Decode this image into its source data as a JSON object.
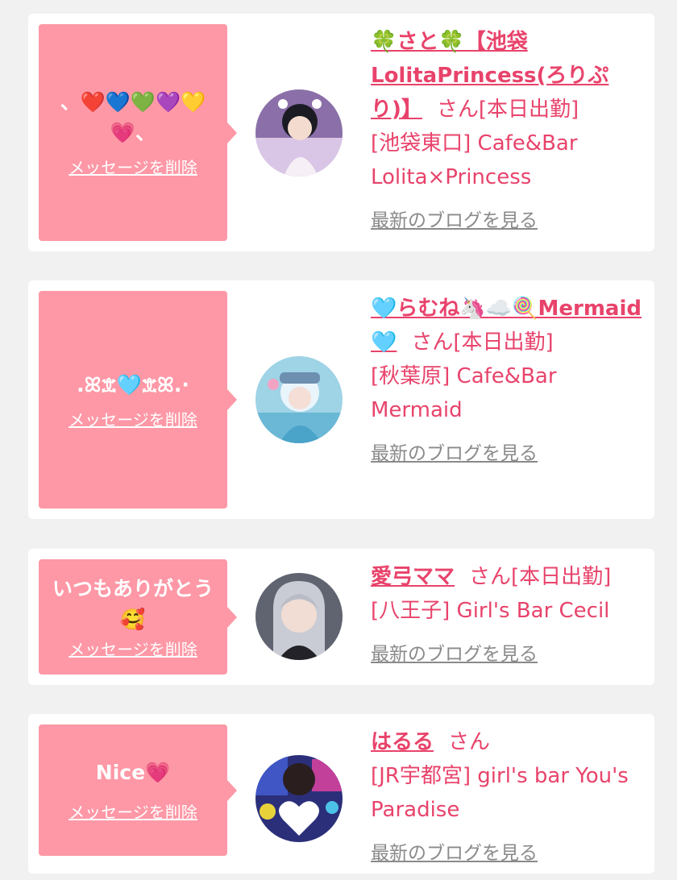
{
  "delete_label": "メッセージを削除",
  "blog_label": "最新のブログを見る",
  "cards": [
    {
      "message": "、❤️💙💚💜💛💗、",
      "name": "🍀さと🍀【池袋LolitaPrincess(ろりぷり)】",
      "suffix": "さん[本日出勤]",
      "shop": "[池袋東口] Cafe&Bar Lolita×Princess"
    },
    {
      "message": ".ꕤ𖠊🩵𖠊ꕤ.·",
      "name": "🩵らむね🦄☁️🍭Mermaid🩵",
      "suffix": "さん[本日出勤]",
      "shop": "[秋葉原] Cafe&Bar Mermaid"
    },
    {
      "message": "いつもありがとう🥰",
      "name": "愛弓ママ",
      "suffix": "さん[本日出勤]",
      "shop": "[八王子] Girl's Bar Cecil"
    },
    {
      "message": "Nice💗",
      "name": "はるる",
      "suffix": "さん",
      "shop": "[JR宇都宮] girl's bar You's Paradise"
    }
  ],
  "colors": {
    "bubble": "#fe98a6",
    "accent": "#e8436b",
    "background": "#f1f1f1"
  }
}
